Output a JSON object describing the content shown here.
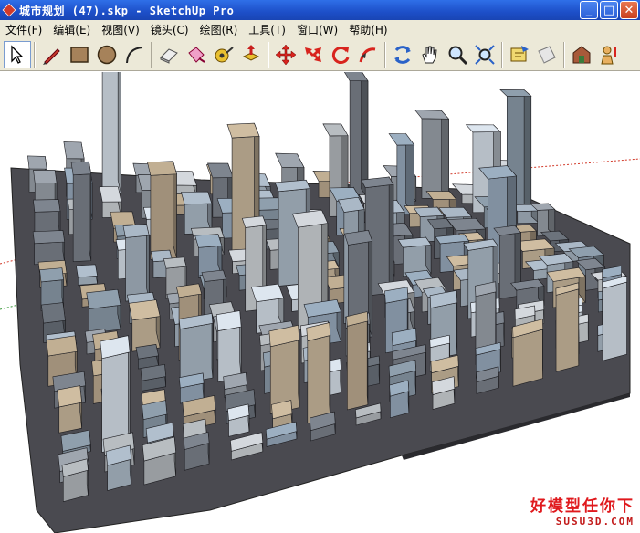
{
  "window": {
    "title": "城市规划 (47).skp - SketchUp Pro",
    "controls": {
      "minimize": "_",
      "maximize": "□",
      "close": "✕"
    }
  },
  "menu": [
    "文件(F)",
    "编辑(E)",
    "视图(V)",
    "镜头(C)",
    "绘图(R)",
    "工具(T)",
    "窗口(W)",
    "帮助(H)"
  ],
  "toolbar": {
    "tools": [
      {
        "id": "select",
        "icon": "select-arrow-icon"
      },
      {
        "id": "line",
        "icon": "pencil-icon"
      },
      {
        "id": "rectangle",
        "icon": "rectangle-icon"
      },
      {
        "id": "circle",
        "icon": "circle-icon"
      },
      {
        "id": "arc",
        "icon": "arc-icon"
      },
      {
        "id": "eraser",
        "icon": "eraser-icon"
      },
      {
        "id": "paint",
        "icon": "paint-bucket-icon"
      },
      {
        "id": "tape",
        "icon": "tape-measure-icon"
      },
      {
        "id": "push-pull",
        "icon": "push-pull-icon"
      },
      {
        "id": "move",
        "icon": "move-icon"
      },
      {
        "id": "rotate",
        "icon": "rotate-icon"
      },
      {
        "id": "follow-me",
        "icon": "follow-me-icon"
      },
      {
        "id": "orbit",
        "icon": "orbit-icon"
      },
      {
        "id": "pan",
        "icon": "pan-hand-icon"
      },
      {
        "id": "zoom",
        "icon": "zoom-icon"
      },
      {
        "id": "zoom-extents",
        "icon": "zoom-extents-icon"
      },
      {
        "id": "components",
        "icon": "components-icon"
      },
      {
        "id": "section",
        "icon": "section-plane-icon"
      },
      {
        "id": "warehouse",
        "icon": "warehouse-icon"
      },
      {
        "id": "place-model",
        "icon": "place-model-icon"
      }
    ]
  },
  "watermark": {
    "text_cn": "好模型任你下",
    "text_en": "SUSU3D.COM"
  },
  "colors": {
    "titlebar": "#1d4fc8",
    "menubar": "#ece9d8",
    "axis_red": "#d23a2a",
    "axis_green": "#3a9a3a",
    "watermark": "#e0191d"
  }
}
